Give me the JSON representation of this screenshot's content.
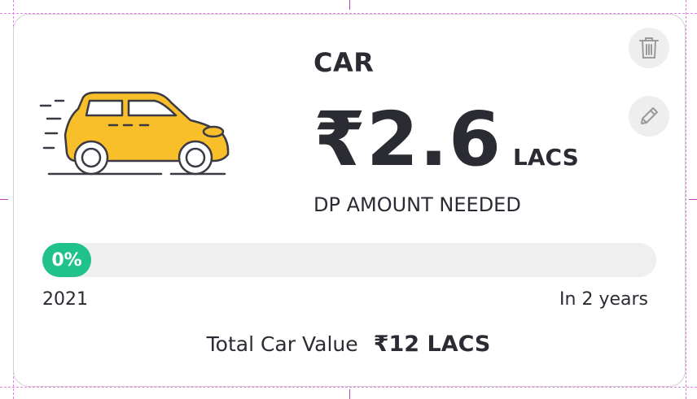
{
  "card": {
    "title": "CAR",
    "amount": "₹2.6",
    "amount_unit": "LACS",
    "subtitle": "DP AMOUNT NEEDED"
  },
  "progress": {
    "value": 0,
    "label": "0%",
    "start_label": "2021",
    "end_label": "In 2 years",
    "fill_color": "#1fc28a"
  },
  "total": {
    "label": "Total Car Value",
    "value": "₹12 LACS"
  },
  "actions": {
    "delete_icon": "trash-icon",
    "edit_icon": "pencil-icon"
  },
  "colors": {
    "car_body": "#f8bf2a",
    "text": "#2b2b33",
    "accent_green": "#1fc28a"
  }
}
